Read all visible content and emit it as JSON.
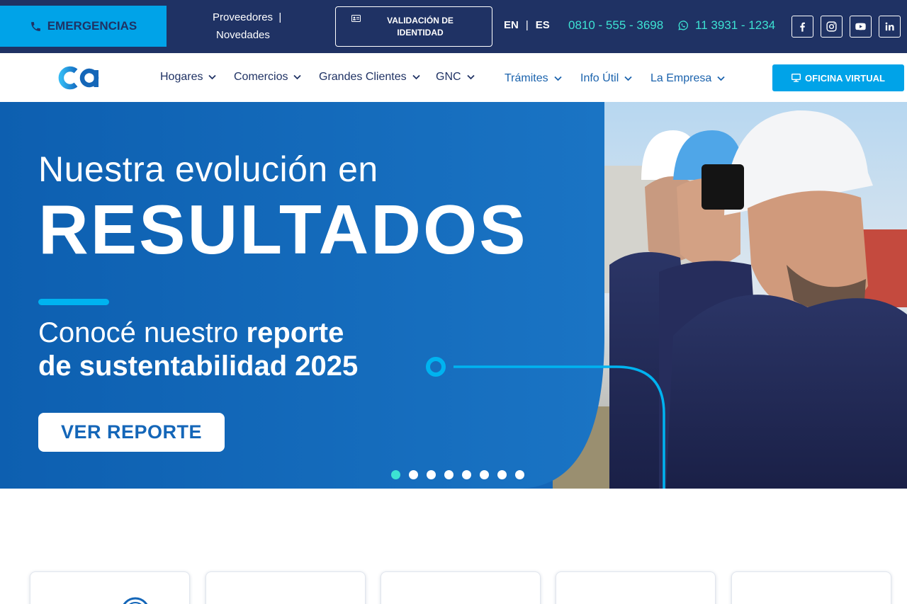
{
  "topbar": {
    "emergency_label": "EMERGENCIAS",
    "proveedores": "Proveedores",
    "proveedores_sep": "|",
    "novedades": "Novedades",
    "validation_label": "VALIDACIÓN DE IDENTIDAD",
    "lang_en": "EN",
    "lang_sep": "|",
    "lang_es": "ES",
    "phone": "0810 - 555 - 3698",
    "whatsapp": "11 3931 - 1234",
    "social": [
      "facebook-icon",
      "instagram-icon",
      "youtube-icon",
      "linkedin-icon"
    ]
  },
  "nav": {
    "items": [
      {
        "label": "Hogares"
      },
      {
        "label": "Comercios"
      },
      {
        "label": "Grandes Clientes"
      },
      {
        "label": "GNC"
      },
      {
        "label": "Trámites"
      },
      {
        "label": "Info Útil"
      },
      {
        "label": "La Empresa"
      }
    ],
    "oficina_label": "OFICINA VIRTUAL"
  },
  "hero": {
    "line1": "Nuestra evolución en",
    "line2": "RESULTADOS",
    "sub_a": "Conocé nuestro ",
    "sub_b": "reporte",
    "sub_c": "de sustentabilidad 2025",
    "button": "VER REPORTE",
    "slides_total": 8,
    "slide_active": 1
  },
  "colors": {
    "topbar": "#1f3264",
    "accent": "#00a3e8",
    "teal": "#3de2d3",
    "hero_blue": "#1466b8"
  }
}
